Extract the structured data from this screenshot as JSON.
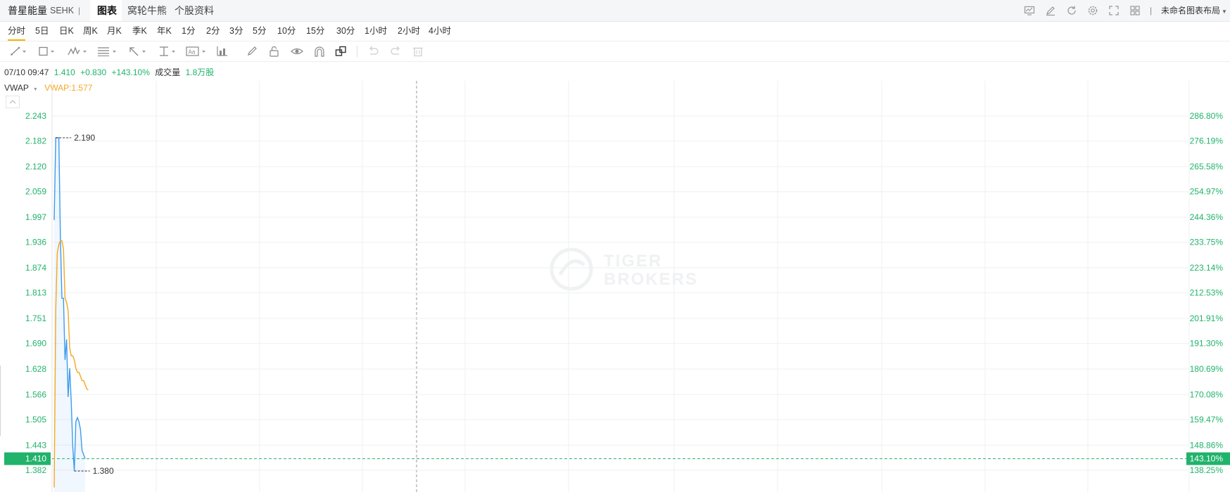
{
  "header": {
    "stock_name": "普星能量",
    "exchange": "SEHK",
    "separator": "|",
    "tabs": [
      "图表",
      "窝轮牛熊",
      "个股资料"
    ],
    "layout_name": "未命名图表布局",
    "right_icons": [
      "indicator-icon",
      "drawing-icon",
      "refresh-icon",
      "settings-icon",
      "fullscreen-icon",
      "layout-grid-icon"
    ]
  },
  "periods": [
    "分时",
    "5日",
    "日K",
    "周K",
    "月K",
    "季K",
    "年K",
    "1分",
    "2分",
    "3分",
    "5分",
    "10分",
    "15分",
    "30分",
    "1小时",
    "2小时",
    "4小时"
  ],
  "active_period": "分时",
  "toolbar_icons": [
    "line-tool-icon",
    "rectangle-tool-icon",
    "wave-tool-icon",
    "fib-tool-icon",
    "arrow-tool-icon",
    "measure-tool-icon",
    "text-tool-icon",
    "bars-tool-icon",
    "pen-icon",
    "lock-icon",
    "eye-icon",
    "magnet-icon",
    "overlap-icon",
    "undo-icon",
    "redo-icon",
    "trash-icon"
  ],
  "info": {
    "datetime": "07/10 09:47",
    "price": "1.410",
    "change": "+0.830",
    "change_pct": "+143.10%",
    "volume_label": "成交量",
    "volume": "1.8万股"
  },
  "indicator": {
    "name": "VWAP",
    "value": "VWAP:1.577"
  },
  "watermark": {
    "line1": "TIGER",
    "line2": "BROKERS"
  },
  "colors": {
    "up": "#21b36b",
    "price_line": "#3d9bee",
    "vwap_line": "#f5a623",
    "grid": "#eef0f2",
    "current_badge": "#21b36b",
    "header_bg": "#f5f6f8"
  },
  "chart_data": {
    "type": "line",
    "y_axis_left": [
      "2.243",
      "2.182",
      "2.120",
      "2.059",
      "1.997",
      "1.936",
      "1.874",
      "1.813",
      "1.751",
      "1.690",
      "1.628",
      "1.566",
      "1.505",
      "1.443",
      "1.382"
    ],
    "y_axis_right": [
      "286.80%",
      "276.19%",
      "265.58%",
      "254.97%",
      "244.36%",
      "233.75%",
      "223.14%",
      "212.53%",
      "201.91%",
      "191.30%",
      "180.69%",
      "170.08%",
      "159.47%",
      "148.86%",
      "138.25%"
    ],
    "ylim": [
      1.35,
      2.26
    ],
    "current_price_label": "1.410",
    "current_pct_label": "143.10%",
    "current_value": 1.41,
    "high_label": "2.190",
    "low_label": "1.380",
    "high_value": 2.19,
    "low_value": 1.38,
    "x_minutes": 330,
    "series": [
      {
        "name": "VWAP",
        "values": [
          [
            0,
            1.34
          ],
          [
            1,
            1.77
          ],
          [
            2,
            1.91
          ],
          [
            3,
            1.93
          ],
          [
            4,
            1.94
          ],
          [
            5,
            1.94
          ],
          [
            6,
            1.92
          ],
          [
            7,
            1.8
          ],
          [
            8,
            1.79
          ],
          [
            9,
            1.77
          ],
          [
            10,
            1.68
          ],
          [
            11,
            1.66
          ],
          [
            12,
            1.66
          ],
          [
            13,
            1.65
          ],
          [
            14,
            1.63
          ],
          [
            15,
            1.62
          ],
          [
            16,
            1.62
          ],
          [
            17,
            1.61
          ],
          [
            18,
            1.6
          ],
          [
            19,
            1.6
          ],
          [
            20,
            1.59
          ],
          [
            21,
            1.58
          ],
          [
            22,
            1.577
          ]
        ]
      },
      {
        "series_role": "price",
        "values": [
          [
            0,
            1.99
          ],
          [
            1,
            2.19
          ],
          [
            2,
            2.19
          ],
          [
            3,
            2.19
          ],
          [
            4,
            1.95
          ],
          [
            5,
            1.8
          ],
          [
            6,
            1.8
          ],
          [
            7,
            1.65
          ],
          [
            8,
            1.7
          ],
          [
            9,
            1.56
          ],
          [
            10,
            1.63
          ],
          [
            11,
            1.55
          ],
          [
            12,
            1.44
          ],
          [
            13,
            1.38
          ],
          [
            14,
            1.5
          ],
          [
            15,
            1.51
          ],
          [
            16,
            1.5
          ],
          [
            17,
            1.48
          ],
          [
            18,
            1.43
          ],
          [
            19,
            1.42
          ],
          [
            20,
            1.41
          ]
        ]
      }
    ]
  }
}
